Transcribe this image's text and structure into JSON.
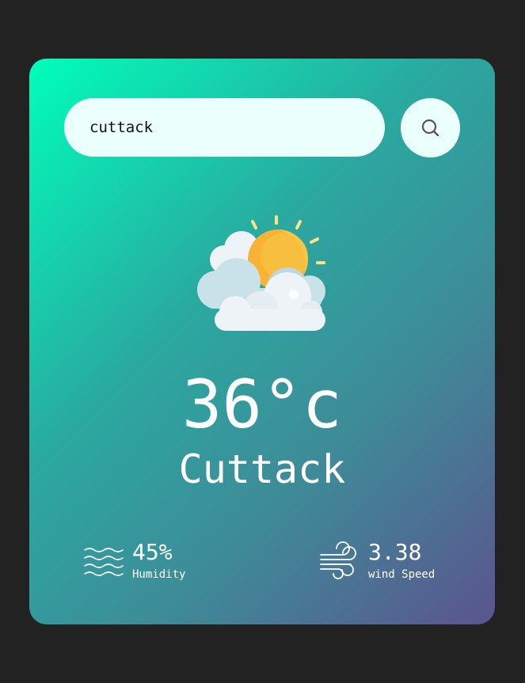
{
  "search": {
    "value": "cuttack"
  },
  "weather": {
    "icon": "partly-cloudy-sun-icon",
    "temperature": "36°c",
    "city": "Cuttack"
  },
  "details": {
    "humidity": {
      "icon": "humidity-waves-icon",
      "value": "45%",
      "label": "Humidity"
    },
    "wind": {
      "icon": "wind-icon",
      "value": "3.38",
      "label": "wind Speed"
    }
  },
  "colors": {
    "page_background": "#222222",
    "card_gradient_start": "#00feba",
    "card_gradient_end": "#5b548e",
    "input_background": "#ebfffc",
    "text": "#ffffff"
  }
}
